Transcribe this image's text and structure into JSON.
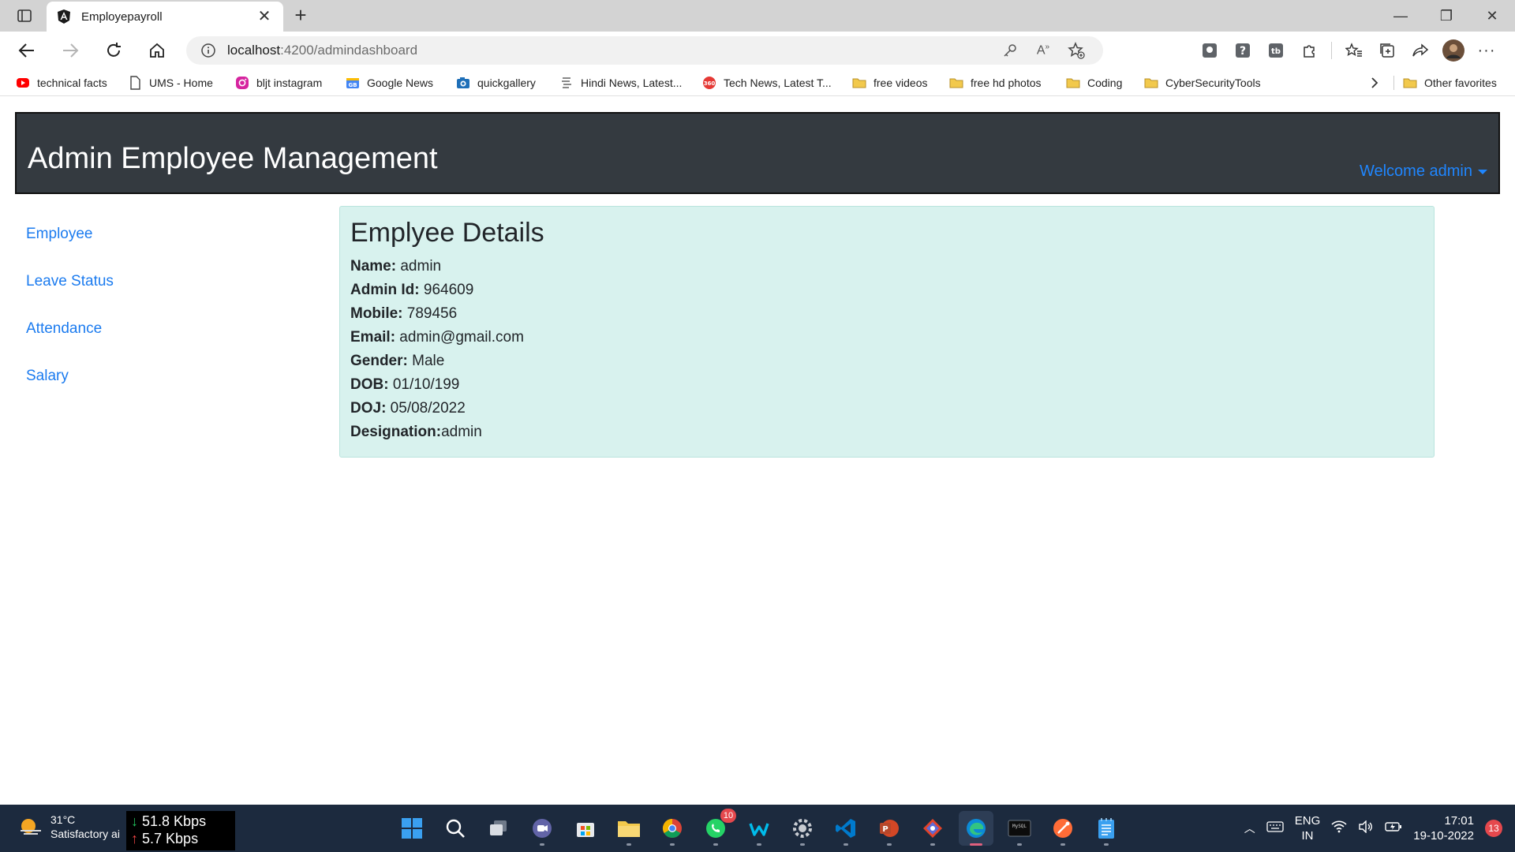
{
  "browser": {
    "tab_title": "Employepayroll",
    "url_host": "localhost",
    "url_path": ":4200/admindashboard",
    "bookmarks": [
      {
        "label": "technical facts",
        "icon": "youtube-icon",
        "color": "#ff0000"
      },
      {
        "label": "UMS - Home",
        "icon": "page-icon",
        "color": "#444444"
      },
      {
        "label": "bljt instagram",
        "icon": "instagram-icon",
        "color": "#d6249f"
      },
      {
        "label": "Google News",
        "icon": "google-news-icon",
        "color": "#4285f4"
      },
      {
        "label": "quickgallery",
        "icon": "camera-icon",
        "color": "#1e6fb8"
      },
      {
        "label": "Hindi News, Latest...",
        "icon": "news-icon",
        "color": "#888888"
      },
      {
        "label": "Tech News, Latest T...",
        "icon": "360-icon",
        "color": "#e53935"
      },
      {
        "label": "free videos",
        "icon": "folder-icon",
        "color": "#f2c94c"
      },
      {
        "label": "free hd photos",
        "icon": "folder-icon",
        "color": "#f2c94c"
      },
      {
        "label": "Coding",
        "icon": "folder-icon",
        "color": "#f2c94c"
      },
      {
        "label": "CyberSecurityTools",
        "icon": "folder-icon",
        "color": "#f2c94c"
      }
    ],
    "other_favorites": "Other favorites"
  },
  "app": {
    "title": "Admin Employee Management",
    "welcome": "Welcome admin",
    "nav": [
      "Employee",
      "Leave Status",
      "Attendance",
      "Salary"
    ],
    "details": {
      "heading": "Emplyee Details",
      "fields": [
        {
          "label": "Name:",
          "value": " admin"
        },
        {
          "label": "Admin Id:",
          "value": " 964609"
        },
        {
          "label": "Mobile:",
          "value": " 789456"
        },
        {
          "label": "Email:",
          "value": " admin@gmail.com"
        },
        {
          "label": "Gender:",
          "value": " Male"
        },
        {
          "label": "DOB:",
          "value": " 01/10/199"
        },
        {
          "label": "DOJ:",
          "value": " 05/08/2022"
        },
        {
          "label": "Designation:",
          "value": "admin"
        }
      ]
    },
    "colors": {
      "header_bg": "#343a40",
      "link": "#1b7bef",
      "details_bg": "#d8f2ee"
    }
  },
  "taskbar": {
    "weather_temp": "31°C",
    "weather_desc": "Satisfactory ai",
    "down_speed": "51.8 Kbps",
    "up_speed": "5.7 Kbps",
    "whatsapp_badge": "10",
    "lang_1": "ENG",
    "lang_2": "IN",
    "time": "17:01",
    "date": "19-10-2022",
    "notifications": "13"
  }
}
